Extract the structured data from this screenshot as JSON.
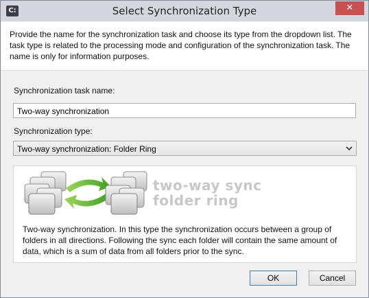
{
  "window": {
    "title": "Select Synchronization Type",
    "app_icon_glyph": "C:",
    "close_glyph": "✕"
  },
  "header": {
    "description": "Provide the name for the synchronization task and choose its type from the dropdown list. The task type is related to the processing mode and configuration of the synchronization task. The name is only for information purposes."
  },
  "form": {
    "name_label": "Synchronization task name:",
    "name_value": "Two-way synchronization",
    "type_label": "Synchronization type:",
    "type_value": "Two-way synchronization: Folder Ring"
  },
  "illustration": {
    "caption_line1": "two-way sync",
    "caption_line2": "folder ring",
    "icons": [
      "folder-stack-icon",
      "sync-arrows-icon",
      "folder-stack-icon"
    ]
  },
  "description": {
    "text": "Two-way synchronization. In this type the synchronization occurs between a group of folders in all directions. Following the sync each folder will contain the same amount of data, which is a sum of data from all folders prior to the sync."
  },
  "buttons": {
    "ok": "OK",
    "cancel": "Cancel"
  },
  "colors": {
    "accent_green": "#5cb82e",
    "close_red": "#c75050",
    "caption_grey": "#c8c8c8"
  }
}
